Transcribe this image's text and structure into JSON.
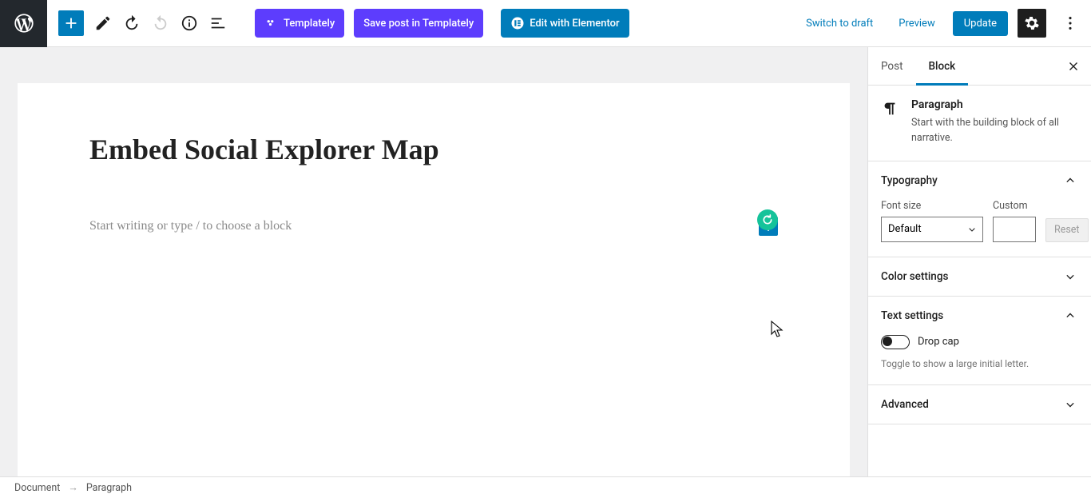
{
  "toolbar": {
    "templately_label": "Templately",
    "save_templately_label": "Save post in Templately",
    "elementor_label": "Edit with Elementor",
    "switch_draft_label": "Switch to draft",
    "preview_label": "Preview",
    "update_label": "Update"
  },
  "editor": {
    "post_title": "Embed Social Explorer Map",
    "paragraph_placeholder": "Start writing or type / to choose a block"
  },
  "sidebar": {
    "tabs": {
      "post": "Post",
      "block": "Block"
    },
    "block_info": {
      "title": "Paragraph",
      "desc": "Start with the building block of all narrative."
    },
    "typography": {
      "heading": "Typography",
      "font_size_label": "Font size",
      "font_size_value": "Default",
      "custom_label": "Custom",
      "reset_label": "Reset"
    },
    "color": {
      "heading": "Color settings"
    },
    "text": {
      "heading": "Text settings",
      "dropcap_label": "Drop cap",
      "dropcap_help": "Toggle to show a large initial letter."
    },
    "advanced": {
      "heading": "Advanced"
    }
  },
  "breadcrumb": {
    "root": "Document",
    "leaf": "Paragraph"
  }
}
